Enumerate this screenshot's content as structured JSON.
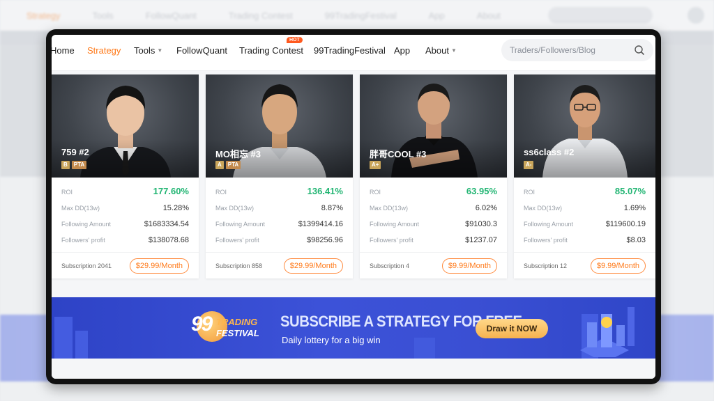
{
  "background_nav": {
    "items": [
      "Strategy",
      "Tools",
      "FollowQuant",
      "Trading Contest",
      "99TradingFestival",
      "App",
      "About"
    ]
  },
  "nav": {
    "items": [
      {
        "label": "Home"
      },
      {
        "label": "Strategy"
      },
      {
        "label": "Tools"
      },
      {
        "label": "FollowQuant"
      },
      {
        "label": "Trading Contest"
      },
      {
        "label": "99TradingFestival"
      },
      {
        "label": "App"
      },
      {
        "label": "About"
      }
    ],
    "hot_badge": "HOT",
    "search_placeholder": "Traders/Followers/Blog",
    "accent_color": "#ff7a1a"
  },
  "labels": {
    "roi": "ROI",
    "max_dd": "Max DD(13w)",
    "following_amount": "Following Amount",
    "followers_profit": "Followers' profit"
  },
  "traders": [
    {
      "name": "759 #2",
      "grade": "B",
      "pta": "PTA",
      "roi": "177.60%",
      "max_dd": "15.28%",
      "following_amount": "$1683334.54",
      "followers_profit": "$138078.68",
      "subscription": "Subscription 2041",
      "price": "$29.99/Month"
    },
    {
      "name": "MO相忘 #3",
      "grade": "A",
      "pta": "PTA",
      "roi": "136.41%",
      "max_dd": "8.87%",
      "following_amount": "$1399414.16",
      "followers_profit": "$98256.96",
      "subscription": "Subscription 858",
      "price": "$29.99/Month"
    },
    {
      "name": "胖哥COOL #3",
      "grade": "A+",
      "roi": "63.95%",
      "max_dd": "6.02%",
      "following_amount": "$91030.3",
      "followers_profit": "$1237.07",
      "subscription": "Subscription 4",
      "price": "$9.99/Month"
    },
    {
      "name": "ss6class #2",
      "grade": "A-",
      "roi": "85.07%",
      "max_dd": "1.69%",
      "following_amount": "$119600.19",
      "followers_profit": "$8.03",
      "subscription": "Subscription 12",
      "price": "$9.99/Month"
    }
  ],
  "banner": {
    "logo_number": "99",
    "logo_line1": "TRADING",
    "logo_line2": "FESTIVAL",
    "title": "SUBSCRIBE A STRATEGY FOR FREE",
    "subtitle": "Daily lottery for a big win",
    "button": "Draw it NOW"
  },
  "colors": {
    "roi_green": "#22b573",
    "banner_blue": "#3a4fd3"
  }
}
